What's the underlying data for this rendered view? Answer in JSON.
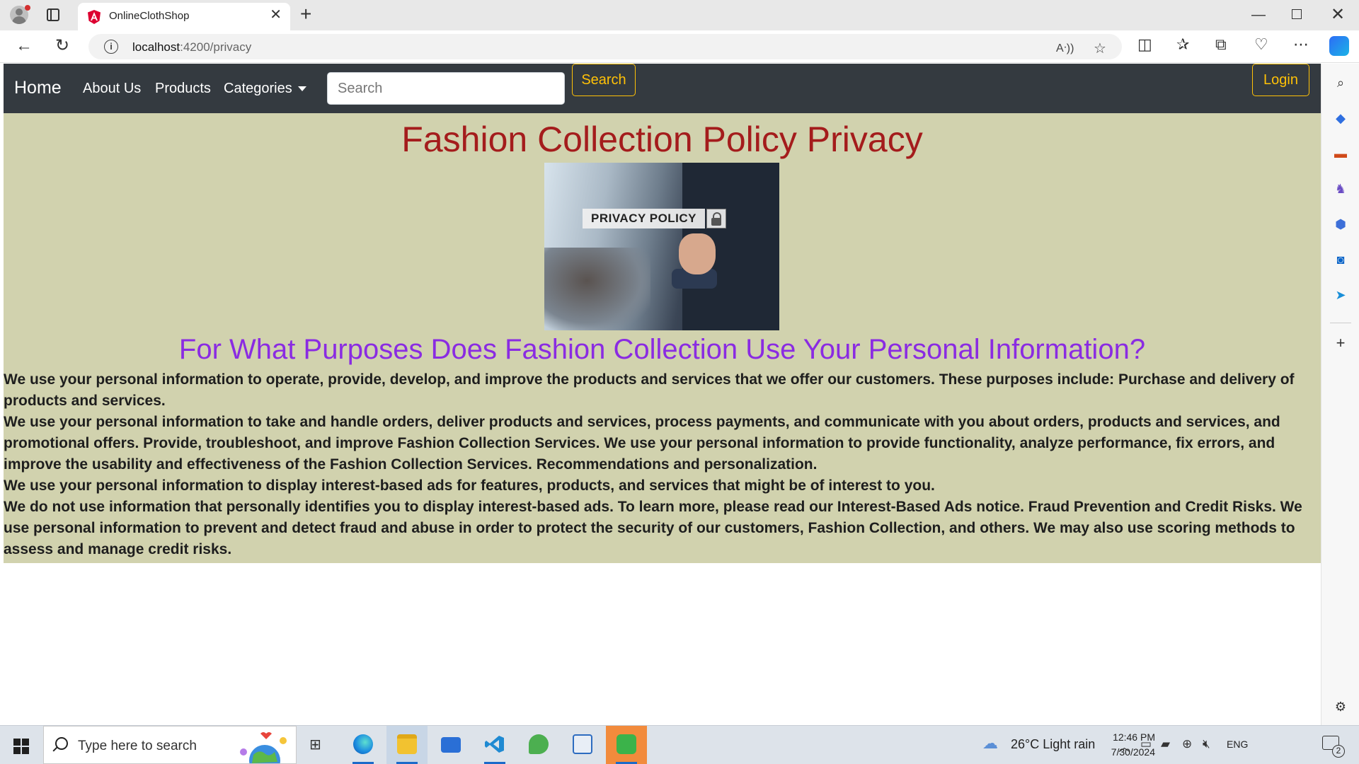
{
  "browser": {
    "tab_title": "OnlineClothShop",
    "url_host": "localhost",
    "url_rest": ":4200/privacy"
  },
  "site": {
    "brand": "Home",
    "nav_links": [
      "About Us",
      "Products",
      "Categories"
    ],
    "search_placeholder": "Search",
    "search_button": "Search",
    "login_button": "Login",
    "colors": {
      "navbar": "#343a40",
      "accent": "#ffc107",
      "content_bg": "#d1d2ae",
      "title": "#a41c1c",
      "subtitle": "#8a2be2"
    }
  },
  "page": {
    "title": "Fashion Collection Policy Privacy",
    "image_label": "PRIVACY POLICY",
    "subtitle": "For What Purposes Does Fashion Collection Use Your Personal Information?",
    "paragraphs": [
      "We use your personal information to operate, provide, develop, and improve the products and services that we offer our customers. These purposes include: Purchase and delivery of products and services.",
      "We use your personal information to take and handle orders, deliver products and services, process payments, and communicate with you about orders, products and services, and promotional offers. Provide, troubleshoot, and improve Fashion Collection Services. We use your personal information to provide functionality, analyze performance, fix errors, and improve the usability and effectiveness of the Fashion Collection Services. Recommendations and personalization.",
      "We use your personal information to display interest-based ads for features, products, and services that might be of interest to you.",
      "We do not use information that personally identifies you to display interest-based ads. To learn more, please read our Interest-Based Ads notice. Fraud Prevention and Credit Risks. We use personal information to prevent and detect fraud and abuse in order to protect the security of our customers, Fashion Collection, and others. We may also use scoring methods to assess and manage credit risks."
    ]
  },
  "taskbar": {
    "search_placeholder": "Type here to search",
    "weather": "26°C  Light rain",
    "language": "ENG",
    "time": "12:46 PM",
    "date": "7/30/2024",
    "notification_count": "2"
  }
}
